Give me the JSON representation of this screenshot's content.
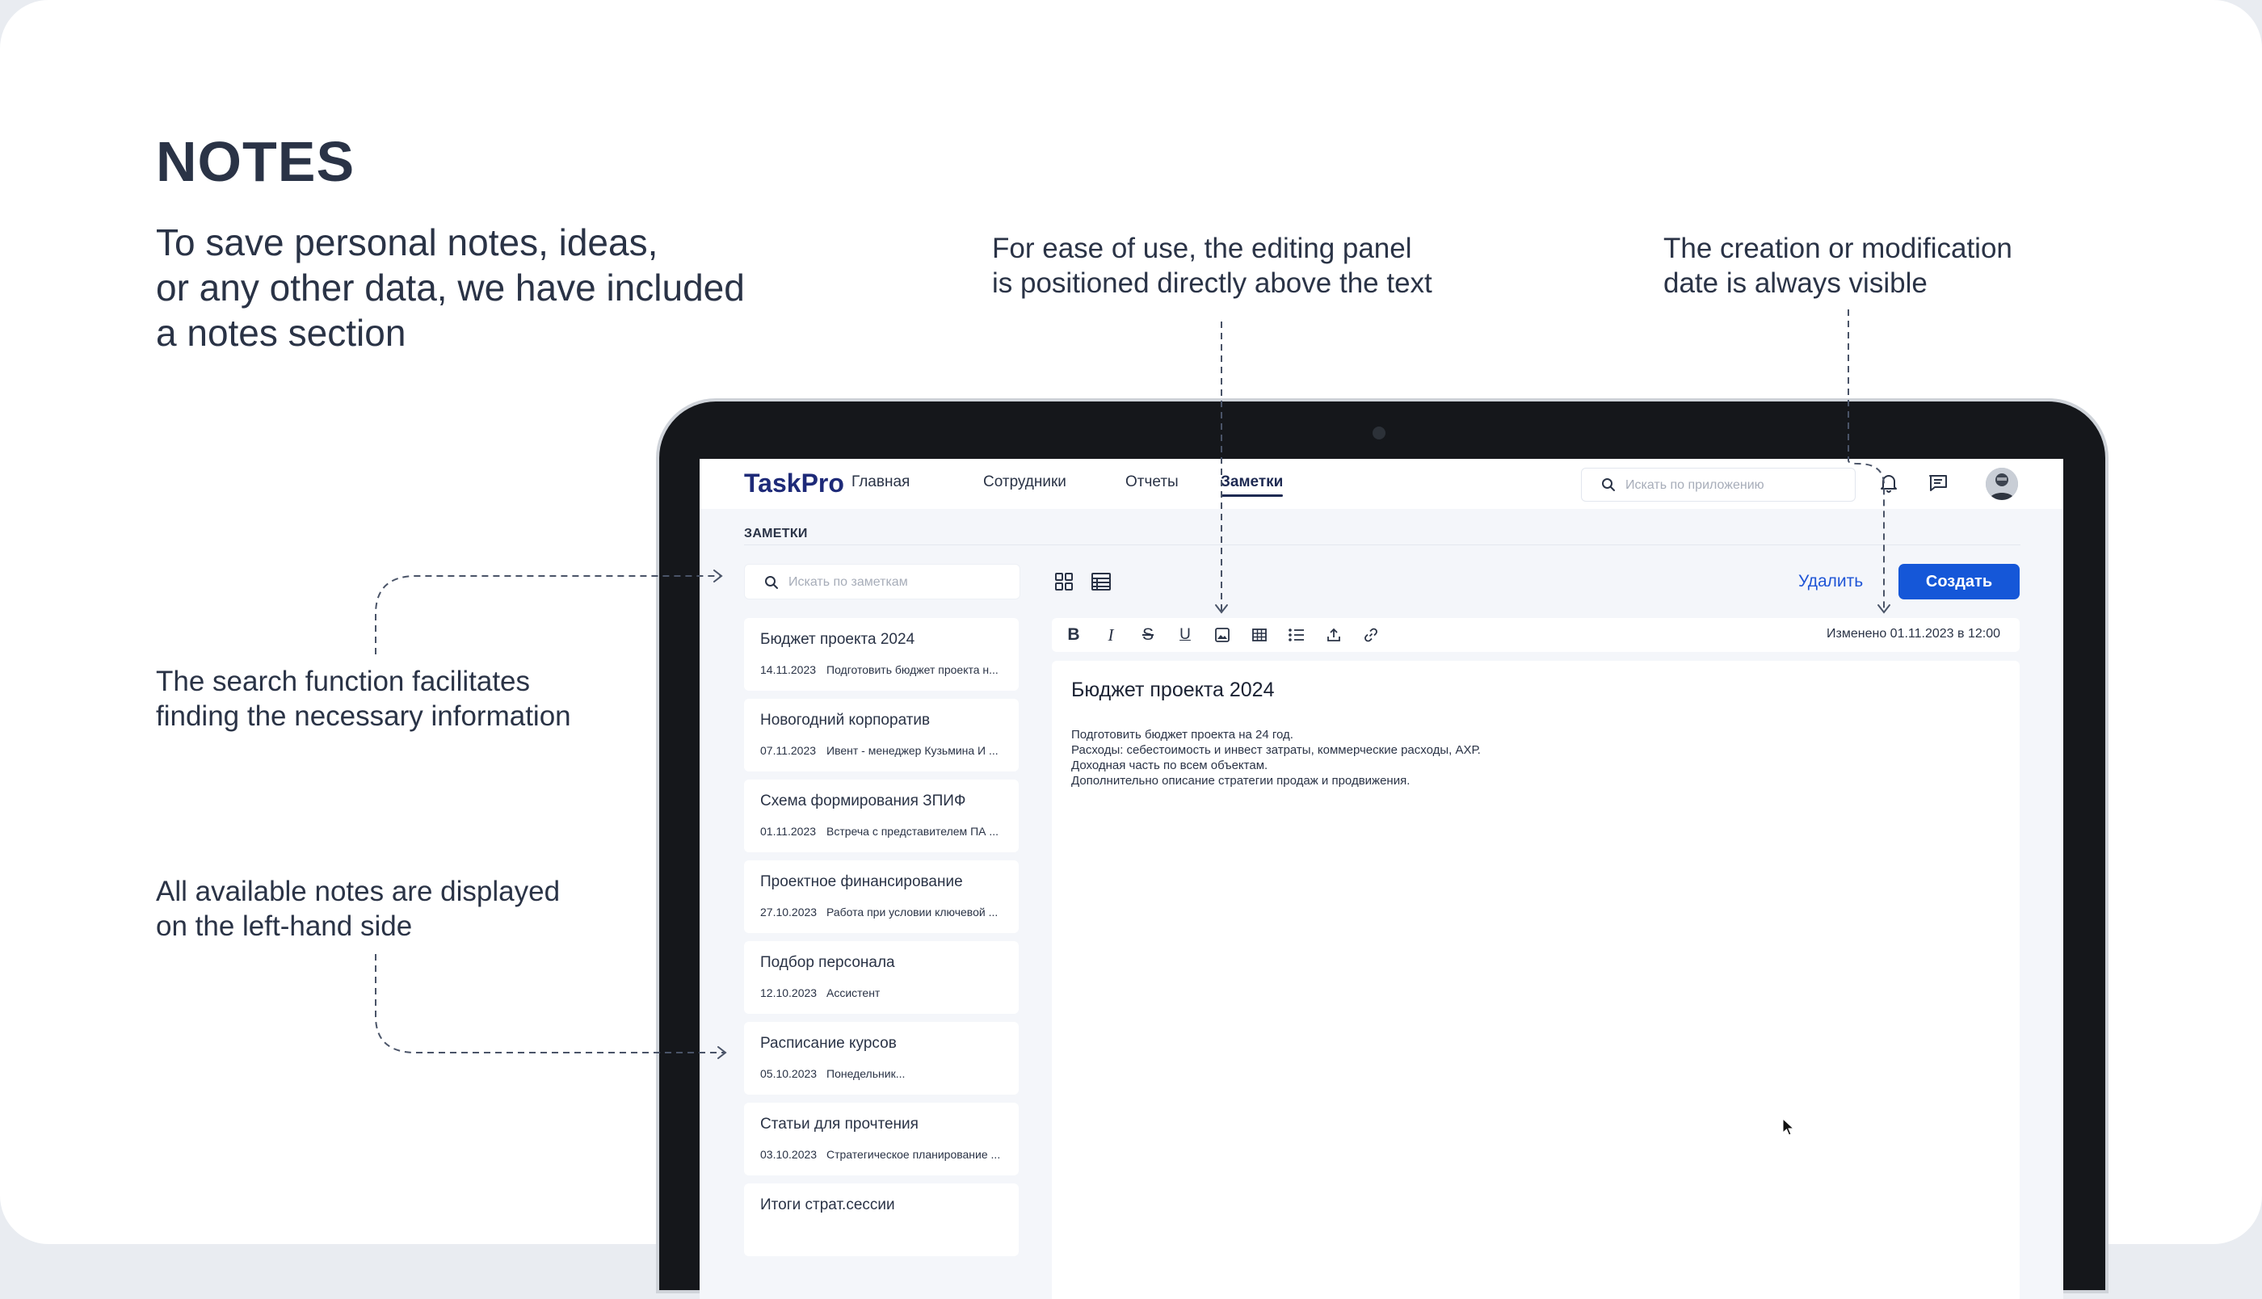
{
  "slide": {
    "title": "NOTES",
    "intro": "To save personal notes, ideas,\nor any other data, we have included\na notes section",
    "annotations": {
      "editor": "For ease of use, the editing panel\nis positioned directly above the text",
      "date": "The creation or modification\ndate is always visible",
      "search": "The search function facilitates\nfinding the necessary information",
      "list": "All available notes are displayed\non the left-hand side"
    }
  },
  "app": {
    "logo": "TaskPro",
    "nav": [
      "Главная",
      "Сотрудники",
      "Отчеты",
      "Заметки"
    ],
    "active_nav": "Заметки",
    "global_search_placeholder": "Искать по приложению",
    "page_heading": "ЗАМЕТКИ",
    "notes_search_placeholder": "Искать по заметкам",
    "delete_label": "Удалить",
    "create_label": "Создать",
    "notes": [
      {
        "title": "Бюджет проекта 2024",
        "date": "14.11.2023",
        "preview": "Подготовить бюджет проекта н..."
      },
      {
        "title": "Новогодний корпоратив",
        "date": "07.11.2023",
        "preview": "Ивент - менеджер Кузьмина И ..."
      },
      {
        "title": "Схема формирования ЗПИФ",
        "date": "01.11.2023",
        "preview": "Встреча с представителем ПА ..."
      },
      {
        "title": "Проектное финансирование",
        "date": "27.10.2023",
        "preview": "Работа при условии ключевой ..."
      },
      {
        "title": "Подбор персонала",
        "date": "12.10.2023",
        "preview": "Ассистент"
      },
      {
        "title": "Расписание курсов",
        "date": "05.10.2023",
        "preview": "Понедельник..."
      },
      {
        "title": "Статьи для прочтения",
        "date": "03.10.2023",
        "preview": "Стратегическое планирование ..."
      },
      {
        "title": "Итоги страт.сессии",
        "date": "",
        "preview": ""
      }
    ],
    "editor": {
      "modified": "Изменено 01.11.2023 в 12:00",
      "title": "Бюджет проекта 2024",
      "body": "Подготовить бюджет проекта на 24 год.\nРасходы: себестоимость и инвест затраты, коммерческие расходы, АХР.\nДоходная часть по всем объектам.\nДополнительно описание стратегии продаж и продвижения."
    },
    "toolbar": {
      "bold": "B",
      "italic": "I",
      "strike": "S",
      "underline": "U"
    },
    "colors": {
      "accent": "#1557d8",
      "logo": "#1e2a78",
      "text": "#2a3346"
    }
  }
}
